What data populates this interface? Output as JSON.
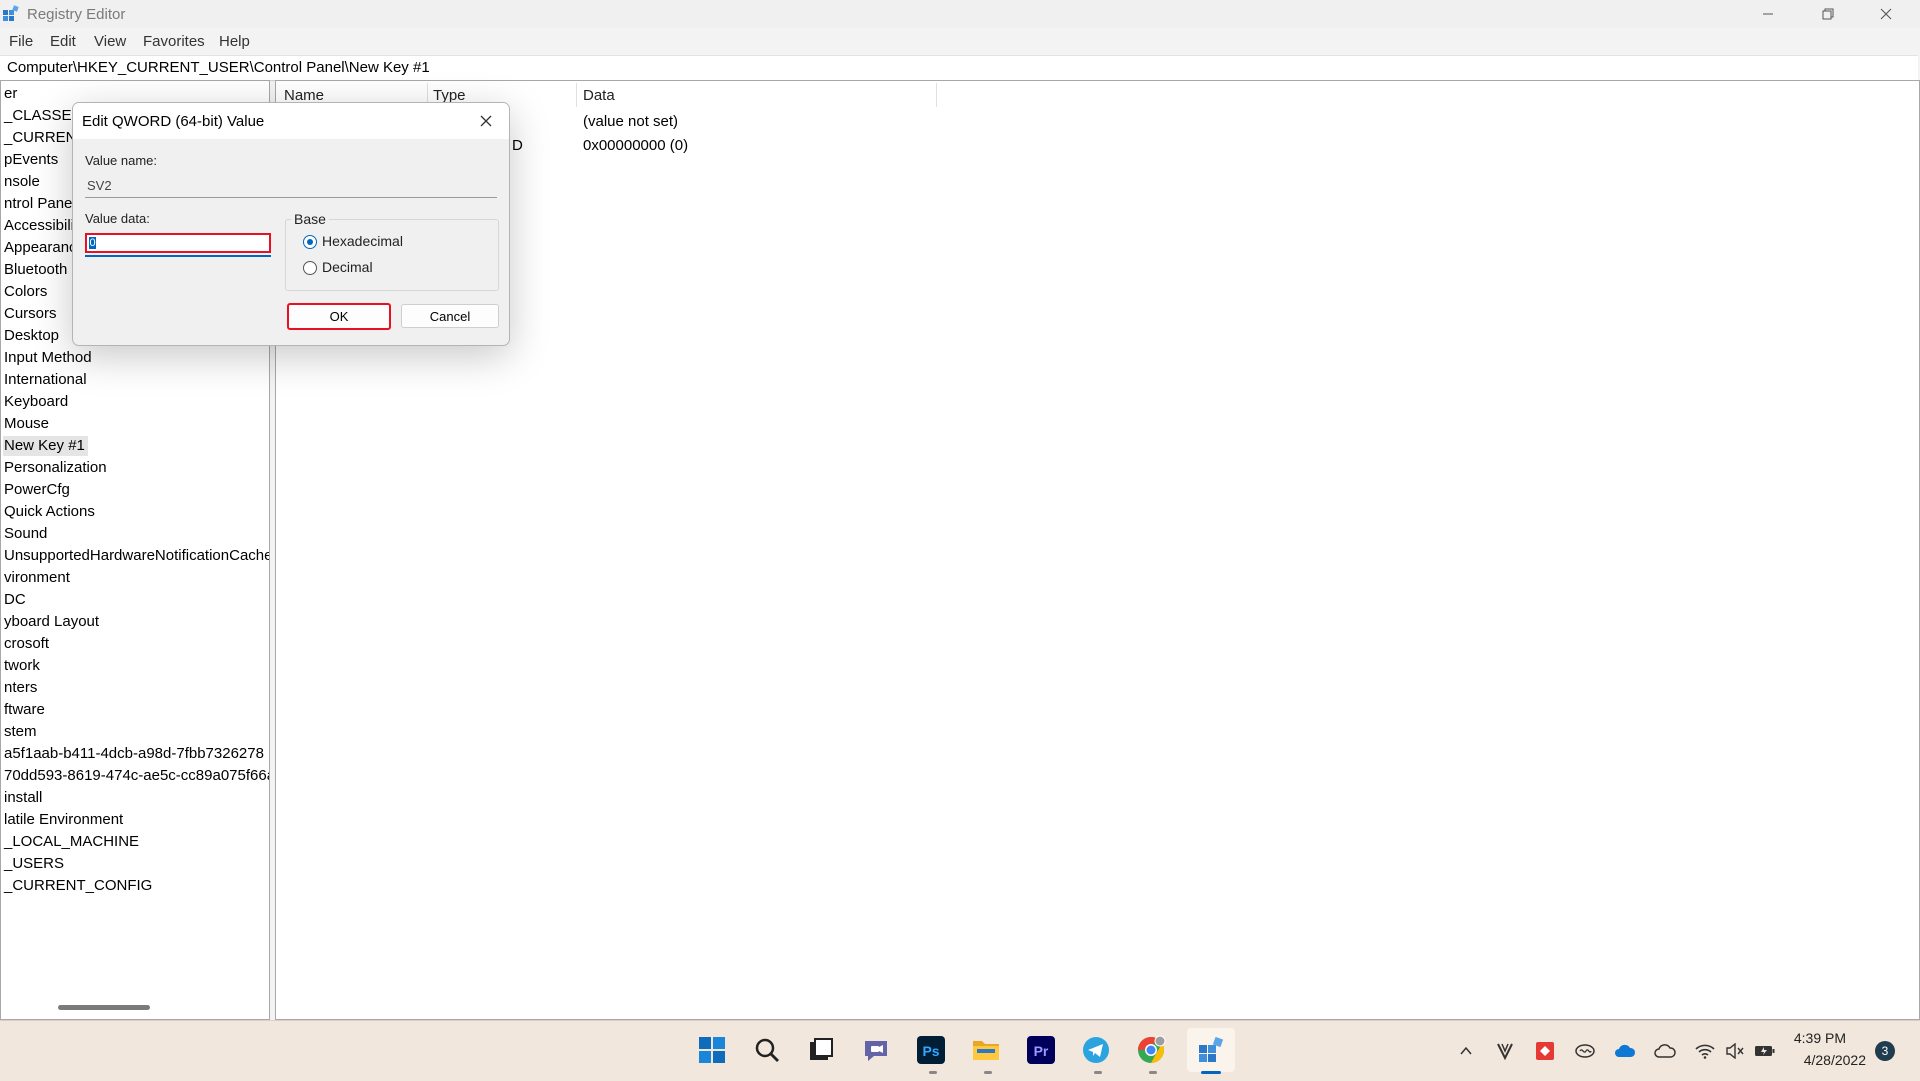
{
  "window": {
    "title": "Registry Editor"
  },
  "menu": [
    "File",
    "Edit",
    "View",
    "Favorites",
    "Help"
  ],
  "address": "Computer\\HKEY_CURRENT_USER\\Control Panel\\New Key #1",
  "tree": [
    "er",
    "_CLASSES_I",
    "_CURRENT_",
    "pEvents",
    "nsole",
    "ntrol Panel",
    "Accessibili",
    "Appearanc",
    "Bluetooth",
    "Colors",
    "Cursors",
    "Desktop",
    "Input Method",
    "International",
    "Keyboard",
    "Mouse",
    "New Key #1",
    "Personalization",
    "PowerCfg",
    "Quick Actions",
    "Sound",
    "UnsupportedHardwareNotificationCache",
    "vironment",
    "DC",
    "yboard Layout",
    "crosoft",
    "twork",
    "nters",
    "ftware",
    "stem",
    "a5f1aab-b411-4dcb-a98d-7fbb7326278",
    "70dd593-8619-474c-ae5c-cc89a075f66a",
    "install",
    "latile Environment",
    "_LOCAL_MACHINE",
    "_USERS",
    "_CURRENT_CONFIG"
  ],
  "list": {
    "columns": [
      "Name",
      "Type",
      "Data"
    ],
    "rows": [
      {
        "type": "",
        "data": "(value not set)"
      },
      {
        "type": "D",
        "data": "0x00000000 (0)"
      }
    ]
  },
  "dialog": {
    "title": "Edit QWORD (64-bit) Value",
    "value_name_label": "Value name:",
    "value_name": "SV2",
    "value_data_label": "Value data:",
    "value_data": "0",
    "base_label": "Base",
    "hex_label": "Hexadecimal",
    "dec_label": "Decimal",
    "ok_label": "OK",
    "cancel_label": "Cancel"
  },
  "clock": {
    "time": "4:39 PM",
    "date": "4/28/2022"
  },
  "notifications": "3"
}
